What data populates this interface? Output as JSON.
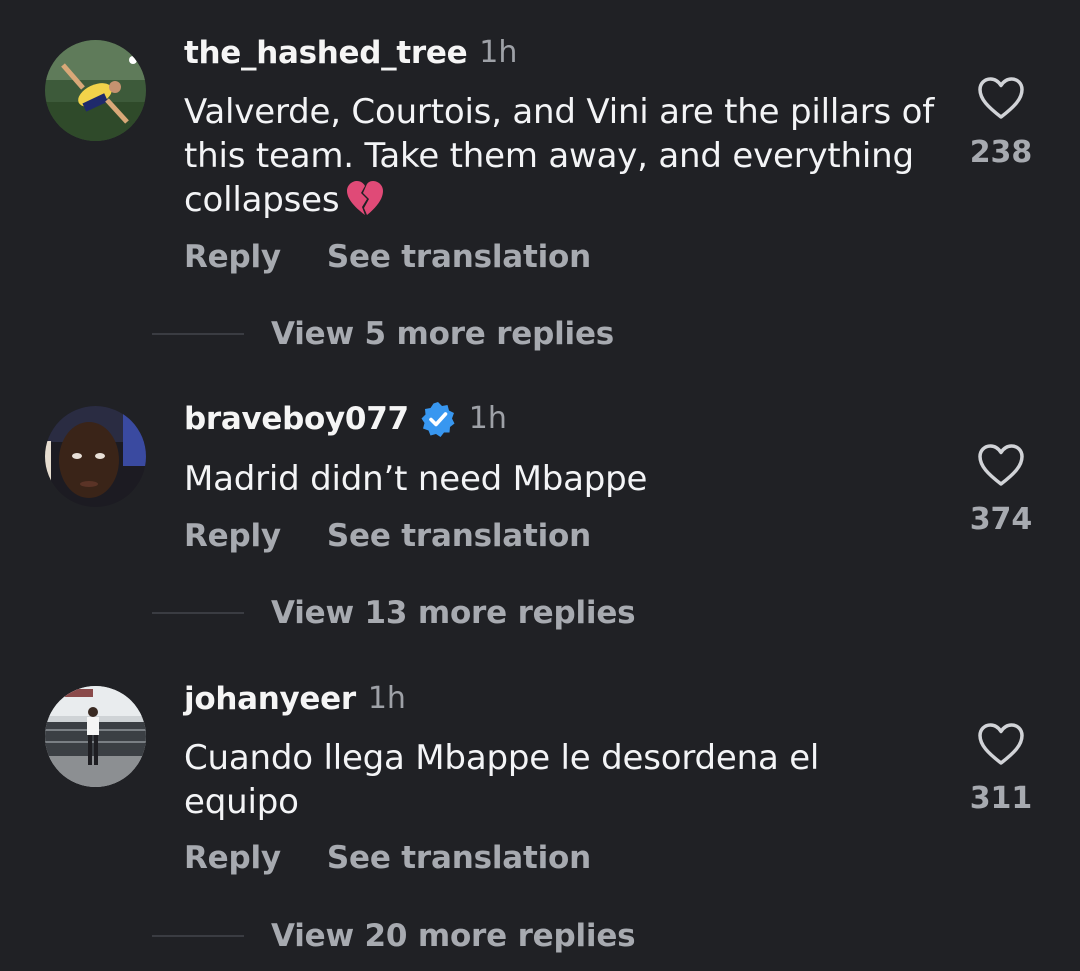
{
  "colors": {
    "background": "#202125",
    "primary_text": "#f3f4f6",
    "secondary_text": "#a7aab0",
    "verified_blue": "#3897f0",
    "heart_outline": "#d1d3d7"
  },
  "comments": [
    {
      "username": "the_hashed_tree",
      "verified": false,
      "time": "1h",
      "text": "Valverde, Courtois, and Vini are the pillars of this team. Take them away, and everything collapses",
      "emoji": "broken-heart-icon",
      "reply_label": "Reply",
      "translate_label": "See translation",
      "like_icon": "heart-outline-icon",
      "likes": "238",
      "view_more": "View 5 more replies"
    },
    {
      "username": "braveboy077",
      "verified": true,
      "time": "1h",
      "text": "Madrid didn’t need Mbappe",
      "reply_label": "Reply",
      "translate_label": "See translation",
      "like_icon": "heart-outline-icon",
      "likes": "374",
      "view_more": "View 13 more replies"
    },
    {
      "username": "johanyeer",
      "verified": false,
      "time": "1h",
      "text": "Cuando llega Mbappe le desordena el equipo",
      "reply_label": "Reply",
      "translate_label": "See translation",
      "like_icon": "heart-outline-icon",
      "likes": "311",
      "view_more": "View 20 more replies"
    }
  ]
}
